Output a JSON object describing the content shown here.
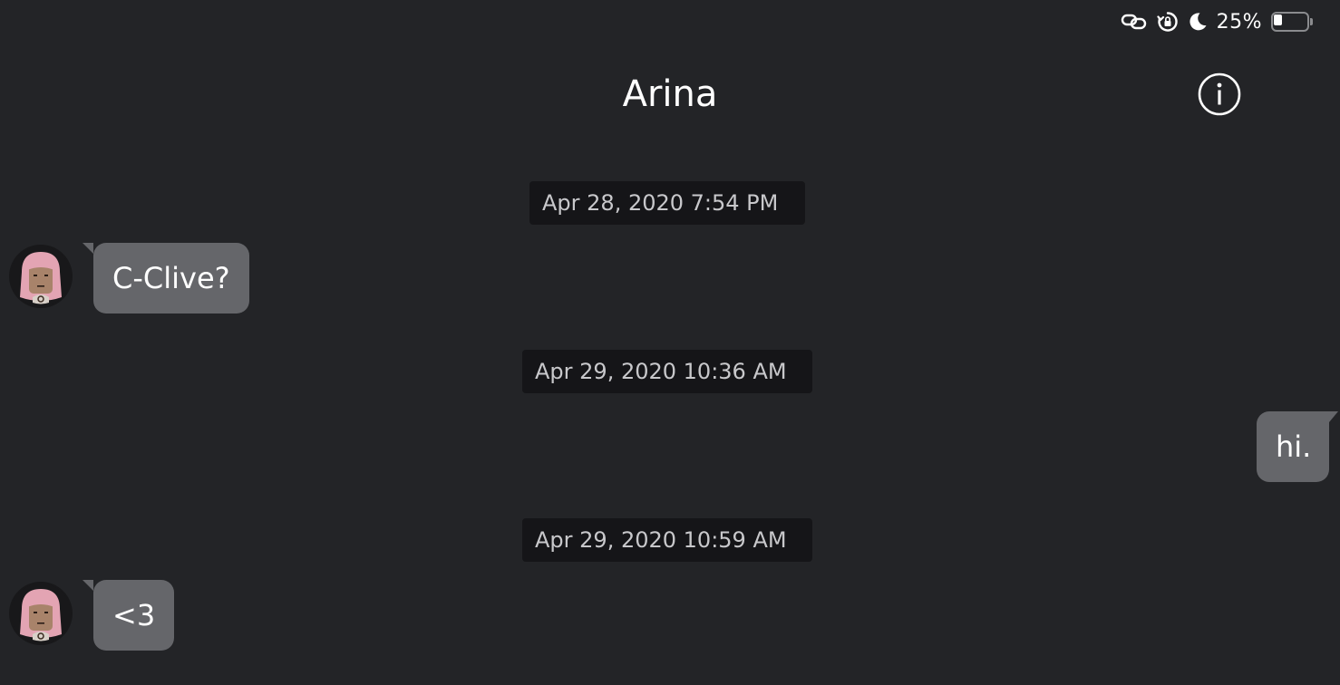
{
  "status_bar": {
    "icons": [
      "link-icon",
      "orientation-lock-icon",
      "moon-icon"
    ],
    "battery_percent": "25%",
    "battery_level": 0.25
  },
  "header": {
    "title": "Arina",
    "info_icon": "info-icon"
  },
  "conversation": [
    {
      "type": "timestamp",
      "text": "Apr 28, 2020 7:54 PM"
    },
    {
      "type": "message",
      "direction": "incoming",
      "text": "C-Clive?"
    },
    {
      "type": "timestamp",
      "text": "Apr 29, 2020 10:36 AM"
    },
    {
      "type": "message",
      "direction": "outgoing",
      "text": "hi."
    },
    {
      "type": "timestamp",
      "text": "Apr 29, 2020 10:59 AM"
    },
    {
      "type": "message",
      "direction": "incoming",
      "text": "<3"
    }
  ],
  "colors": {
    "background": "#232427",
    "bubble": "#65666a",
    "timestamp_background": "#151518",
    "timestamp_text": "#c8c8cb"
  }
}
